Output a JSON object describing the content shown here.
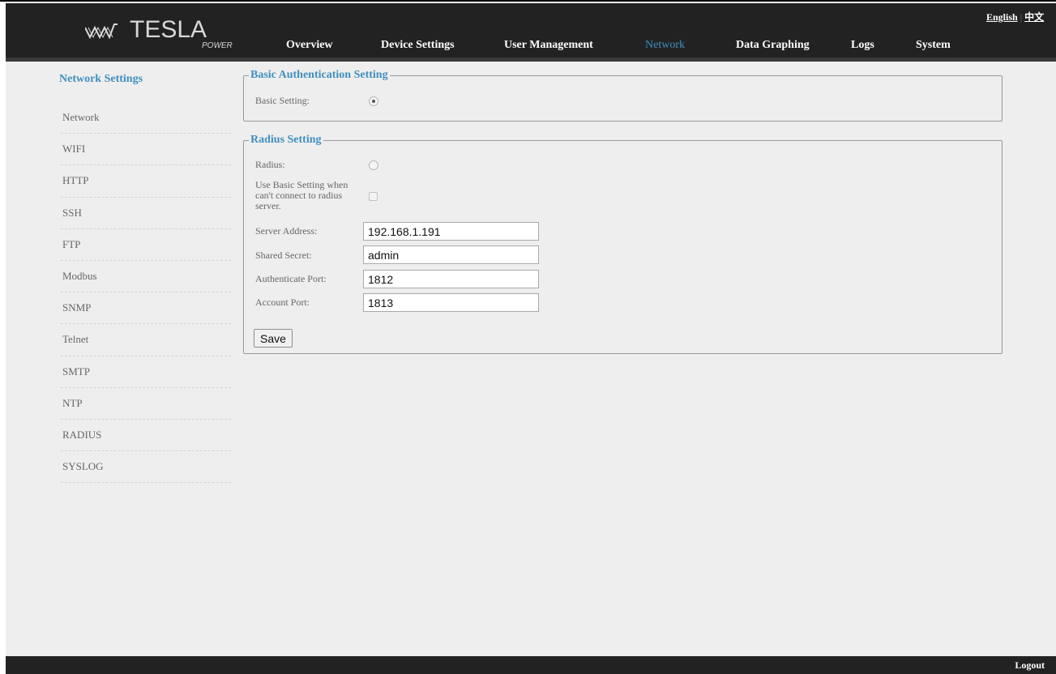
{
  "header": {
    "logo": {
      "text": "TESLA",
      "subtext": "POWER"
    },
    "nav": [
      {
        "label": "Overview",
        "active": false
      },
      {
        "label": "Device Settings",
        "active": false
      },
      {
        "label": "User Management",
        "active": false
      },
      {
        "label": "Network",
        "active": true
      },
      {
        "label": "Data Graphing",
        "active": false
      },
      {
        "label": "Logs",
        "active": false
      },
      {
        "label": "System",
        "active": false
      }
    ],
    "lang": {
      "english": "English",
      "chinese": "中文"
    }
  },
  "sidebar": {
    "title": "Network Settings",
    "items": [
      {
        "label": "Network"
      },
      {
        "label": "WIFI"
      },
      {
        "label": "HTTP"
      },
      {
        "label": "SSH"
      },
      {
        "label": "FTP"
      },
      {
        "label": "Modbus"
      },
      {
        "label": "SNMP"
      },
      {
        "label": "Telnet"
      },
      {
        "label": "SMTP"
      },
      {
        "label": "NTP"
      },
      {
        "label": "RADIUS"
      },
      {
        "label": "SYSLOG"
      }
    ]
  },
  "basic_auth": {
    "legend": "Basic Authentication Setting",
    "basic_setting_label": "Basic Setting:",
    "basic_setting_checked": true
  },
  "radius": {
    "legend": "Radius Setting",
    "radius_label": "Radius:",
    "radius_checked": false,
    "fallback_label_line1": "Use Basic Setting when",
    "fallback_label_line2": "can't connect to radius",
    "fallback_label_line3": "server.",
    "fallback_checked": false,
    "server_address_label": "Server Address:",
    "server_address_value": "192.168.1.191",
    "shared_secret_label": "Shared Secret:",
    "shared_secret_value": "admin",
    "auth_port_label": "Authenticate Port:",
    "auth_port_value": "1812",
    "account_port_label": "Account Port:",
    "account_port_value": "1813",
    "save_label": "Save"
  },
  "footer": {
    "logout": "Logout"
  },
  "colors": {
    "header_bg": "#222222",
    "accent": "#3f8fbe",
    "content_bg": "#eeeeee"
  },
  "icons": {
    "logo": "tesla-power-logo-icon"
  }
}
